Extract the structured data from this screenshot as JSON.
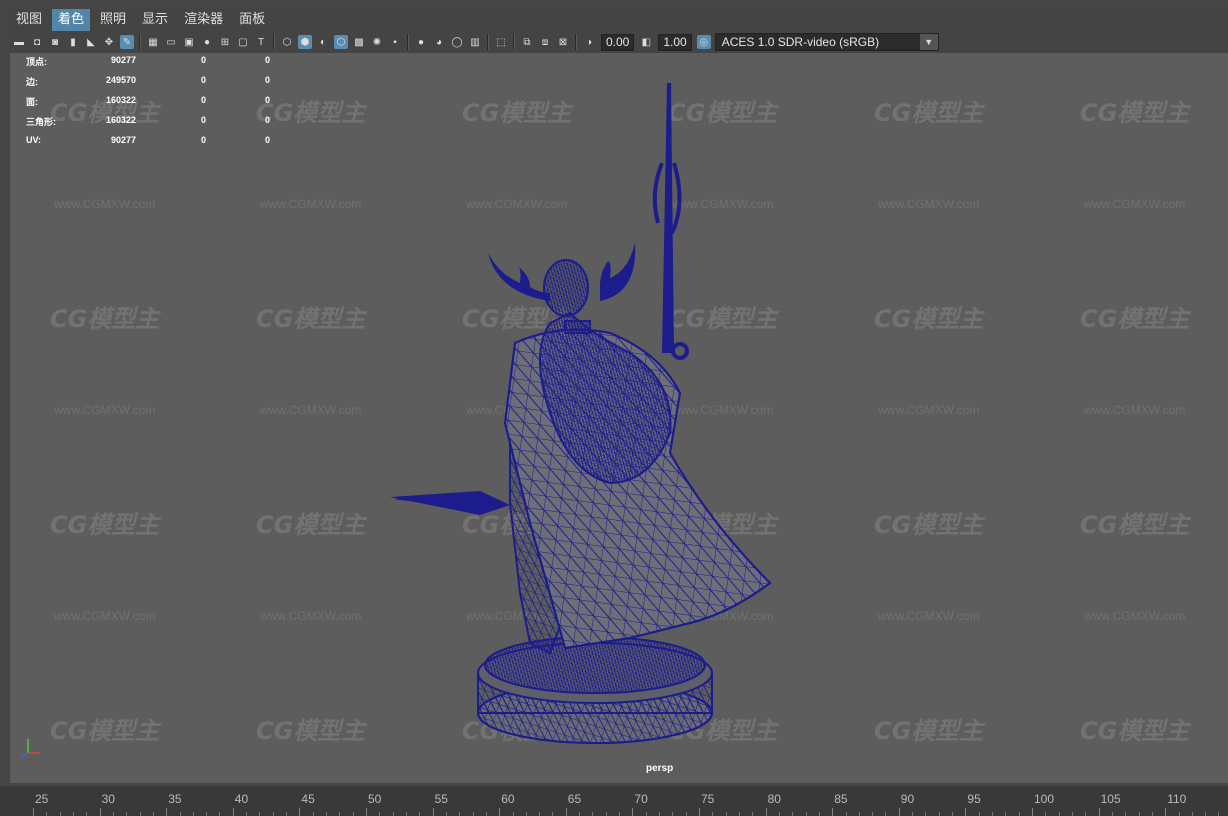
{
  "menu": {
    "items": [
      {
        "label": "视图",
        "active": false
      },
      {
        "label": "着色",
        "active": true
      },
      {
        "label": "照明",
        "active": false
      },
      {
        "label": "显示",
        "active": false
      },
      {
        "label": "渲染器",
        "active": false
      },
      {
        "label": "面板",
        "active": false
      }
    ]
  },
  "toolbar": {
    "exposure": "0.00",
    "gamma": "1.00",
    "color_space": "ACES 1.0 SDR-video (sRGB)",
    "icons": [
      "camera-select-icon",
      "camera-lock-icon",
      "camera-attributes-icon",
      "bookmark-icon",
      "image-plane-icon",
      "2d-pan-zoom-icon",
      "grease-pencil-icon",
      "grid-icon",
      "film-gate-icon",
      "resolution-gate-icon",
      "gate-mask-icon",
      "field-chart-icon",
      "safe-action-icon",
      "safe-title-icon",
      "wireframe-icon",
      "smooth-shade-icon",
      "default-material-icon",
      "wireframe-on-shaded-icon",
      "xray-icon",
      "use-lights-icon",
      "shadows-icon",
      "screen-space-ao-icon",
      "motion-blur-icon",
      "multisample-aa-icon",
      "depth-of-field-icon",
      "isolate-select-icon",
      "xray-joints-icon",
      "xray-active-icon",
      "backface-culling-icon",
      "exposure-icon",
      "gamma-icon",
      "view-transform-icon"
    ]
  },
  "hud": {
    "rows": [
      {
        "label": "顶点:",
        "v1": "90277",
        "v2": "0",
        "v3": "0"
      },
      {
        "label": "边:",
        "v1": "249570",
        "v2": "0",
        "v3": "0"
      },
      {
        "label": "面:",
        "v1": "160322",
        "v2": "0",
        "v3": "0"
      },
      {
        "label": "三角形:",
        "v1": "160322",
        "v2": "0",
        "v3": "0"
      },
      {
        "label": "UV:",
        "v1": "90277",
        "v2": "0",
        "v3": "0"
      }
    ]
  },
  "viewport": {
    "camera_label": "persp",
    "watermark_text": "CG模型主",
    "watermark_url": "www.CGMXW.com",
    "wire_color": "#1c1c8c",
    "background_color": "#5d5d5d"
  },
  "timeline": {
    "ticks": [
      "25",
      "30",
      "35",
      "40",
      "45",
      "50",
      "55",
      "60",
      "65",
      "70",
      "75",
      "80",
      "85",
      "90",
      "95",
      "100",
      "105",
      "110"
    ]
  },
  "colors": {
    "accent": "#5285a6",
    "highlight_icon": "#5a8db0"
  }
}
